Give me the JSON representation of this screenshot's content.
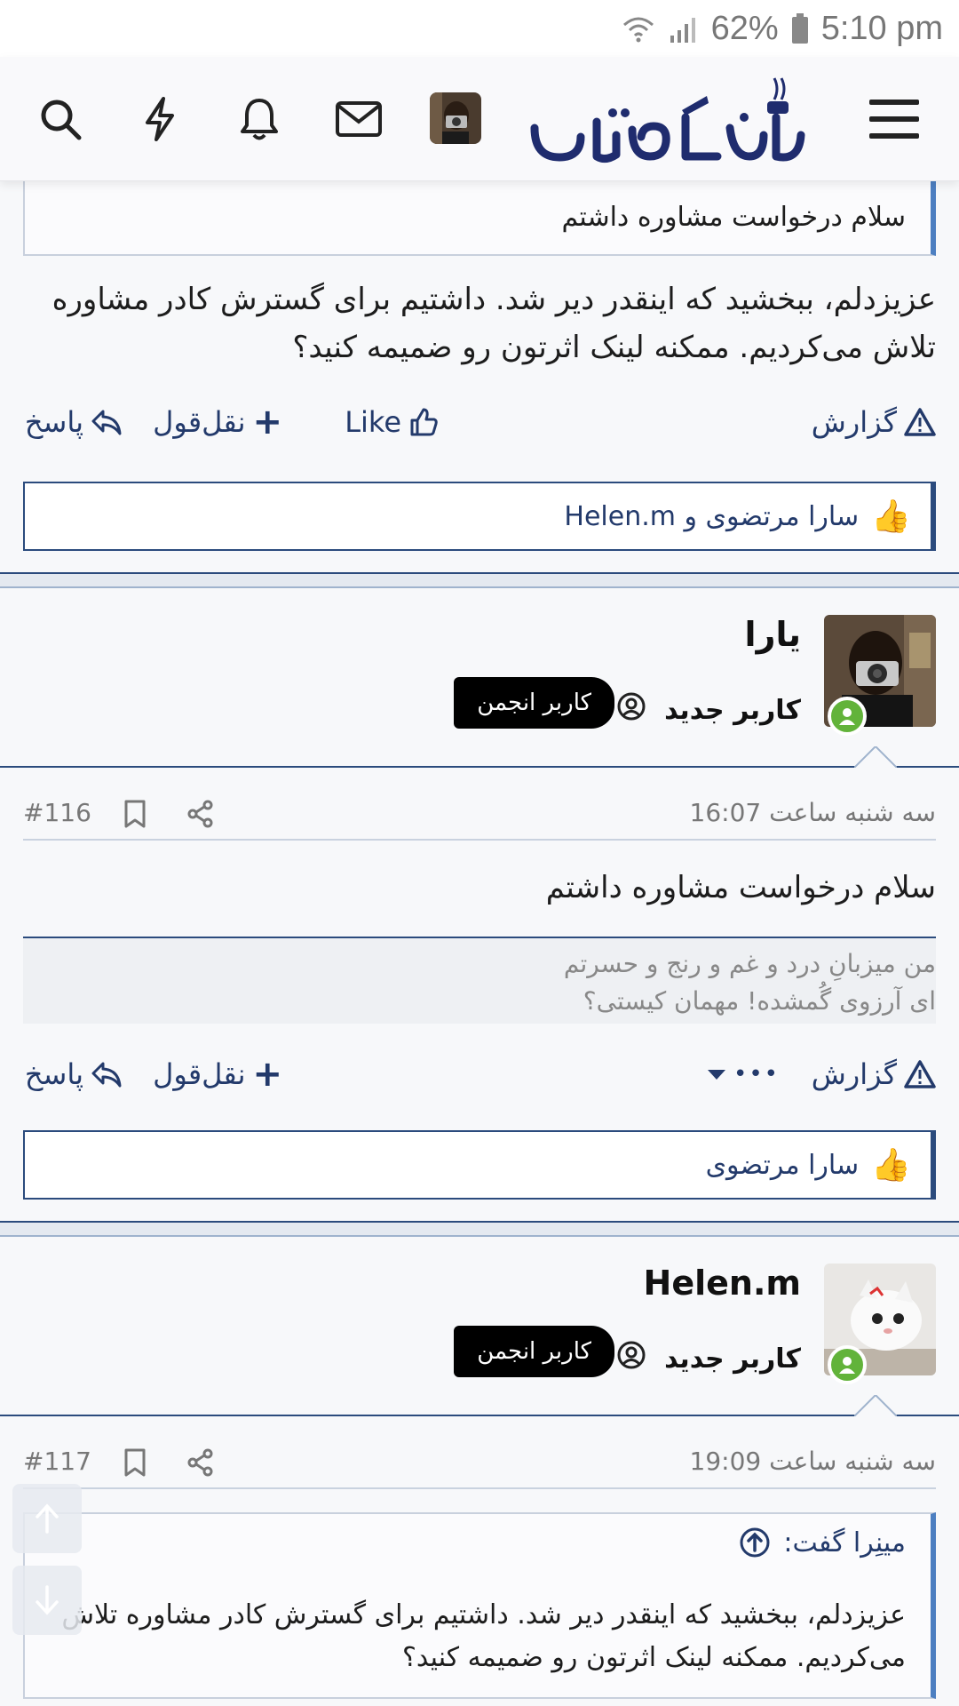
{
  "status_bar": {
    "battery": "62%",
    "time": "5:10 pm"
  },
  "header": {
    "logo_alt": "دافه‌نویسان",
    "icons": [
      "menu-icon",
      "search-icon",
      "bolt-icon",
      "bell-icon",
      "mail-icon"
    ]
  },
  "post_prev": {
    "quote_text": "سلام درخواست مشاوره داشتم",
    "body": "عزیزدلم، ببخشید که اینقدر دیر شد. داشتیم برای گسترش کادر مشاوره تلاش می‌کردیم. ممکنه لینک اثرتون رو ضمیمه کنید؟",
    "actions": {
      "report": "گزارش",
      "like": "Like",
      "quote": "نقل‌قول",
      "reply": "پاسخ"
    },
    "likes": "سارا مرتضوی و Helen.m"
  },
  "post_116": {
    "username": "یارا",
    "user_title": "کاربر جدید",
    "badge": "کاربر انجمن",
    "date": "سه شنبه ساعت 16:07",
    "number": "#116",
    "body": "سلام درخواست مشاوره داشتم",
    "signature": [
      "من میزبانِ درد و غم و رنج و حسرتم",
      "ای آرزوی گُمشده! مهمان کیستی؟"
    ],
    "actions": {
      "report": "گزارش",
      "more": "•••",
      "quote": "نقل‌قول",
      "reply": "پاسخ"
    },
    "likes": "سارا مرتضوی"
  },
  "post_117": {
    "username": "Helen.m",
    "user_title": "کاربر جدید",
    "badge": "کاربر انجمن",
    "date": "سه شنبه ساعت 19:09",
    "number": "#117",
    "quote_author": "مینِرا گفت:",
    "quote_body": "عزیزدلم، ببخشید که اینقدر دیر شد. داشتیم برای گسترش کادر مشاوره تلاش می‌کردیم. ممکنه لینک اثرتون رو ضمیمه کنید؟"
  },
  "colors": {
    "brand": "#233a6b",
    "accent": "#4d7fc1",
    "online": "#62b33a"
  }
}
